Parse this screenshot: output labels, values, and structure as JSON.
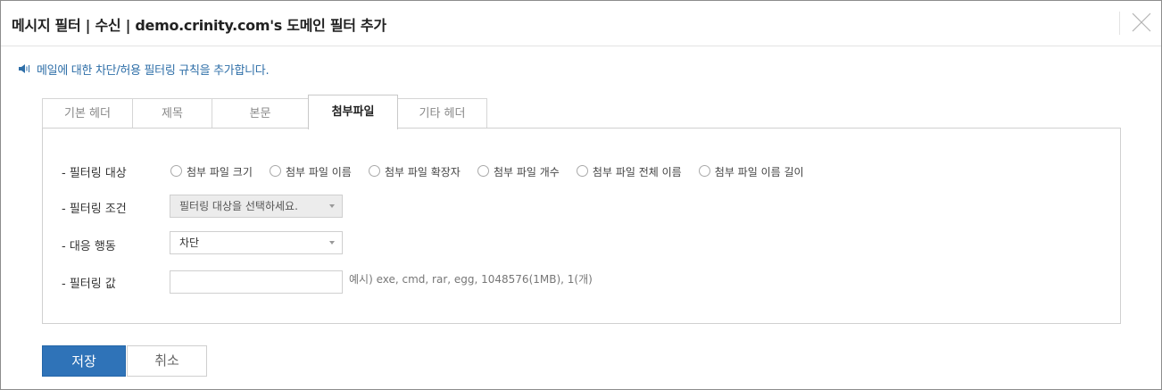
{
  "dialog": {
    "title": "메시지 필터 | 수신 | demo.crinity.com's 도메인 필터 추가",
    "description": "메일에 대한 차단/허용 필터링 규칙을 추가합니다."
  },
  "tabs": [
    {
      "label": "기본 헤더",
      "active": false
    },
    {
      "label": "제목",
      "active": false
    },
    {
      "label": "본문",
      "active": false
    },
    {
      "label": "첨부파일",
      "active": true
    },
    {
      "label": "기타 헤더",
      "active": false
    }
  ],
  "form": {
    "target_label": "- 필터링 대상",
    "target_options": [
      "첨부 파일 크기",
      "첨부 파일 이름",
      "첨부 파일 확장자",
      "첨부 파일 개수",
      "첨부 파일 전체 이름",
      "첨부 파일 이름 길이"
    ],
    "condition_label": "- 필터링 조건",
    "condition_placeholder": "필터링 대상을 선택하세요.",
    "action_label": "- 대응 행동",
    "action_value": "차단",
    "value_label": "- 필터링 값",
    "value_input": "",
    "value_hint": "예시) exe, cmd, rar, egg, 1048576(1MB), 1(개)"
  },
  "buttons": {
    "save": "저장",
    "cancel": "취소"
  },
  "colors": {
    "primary": "#2f73b8",
    "info_text": "#2f6fa8"
  }
}
